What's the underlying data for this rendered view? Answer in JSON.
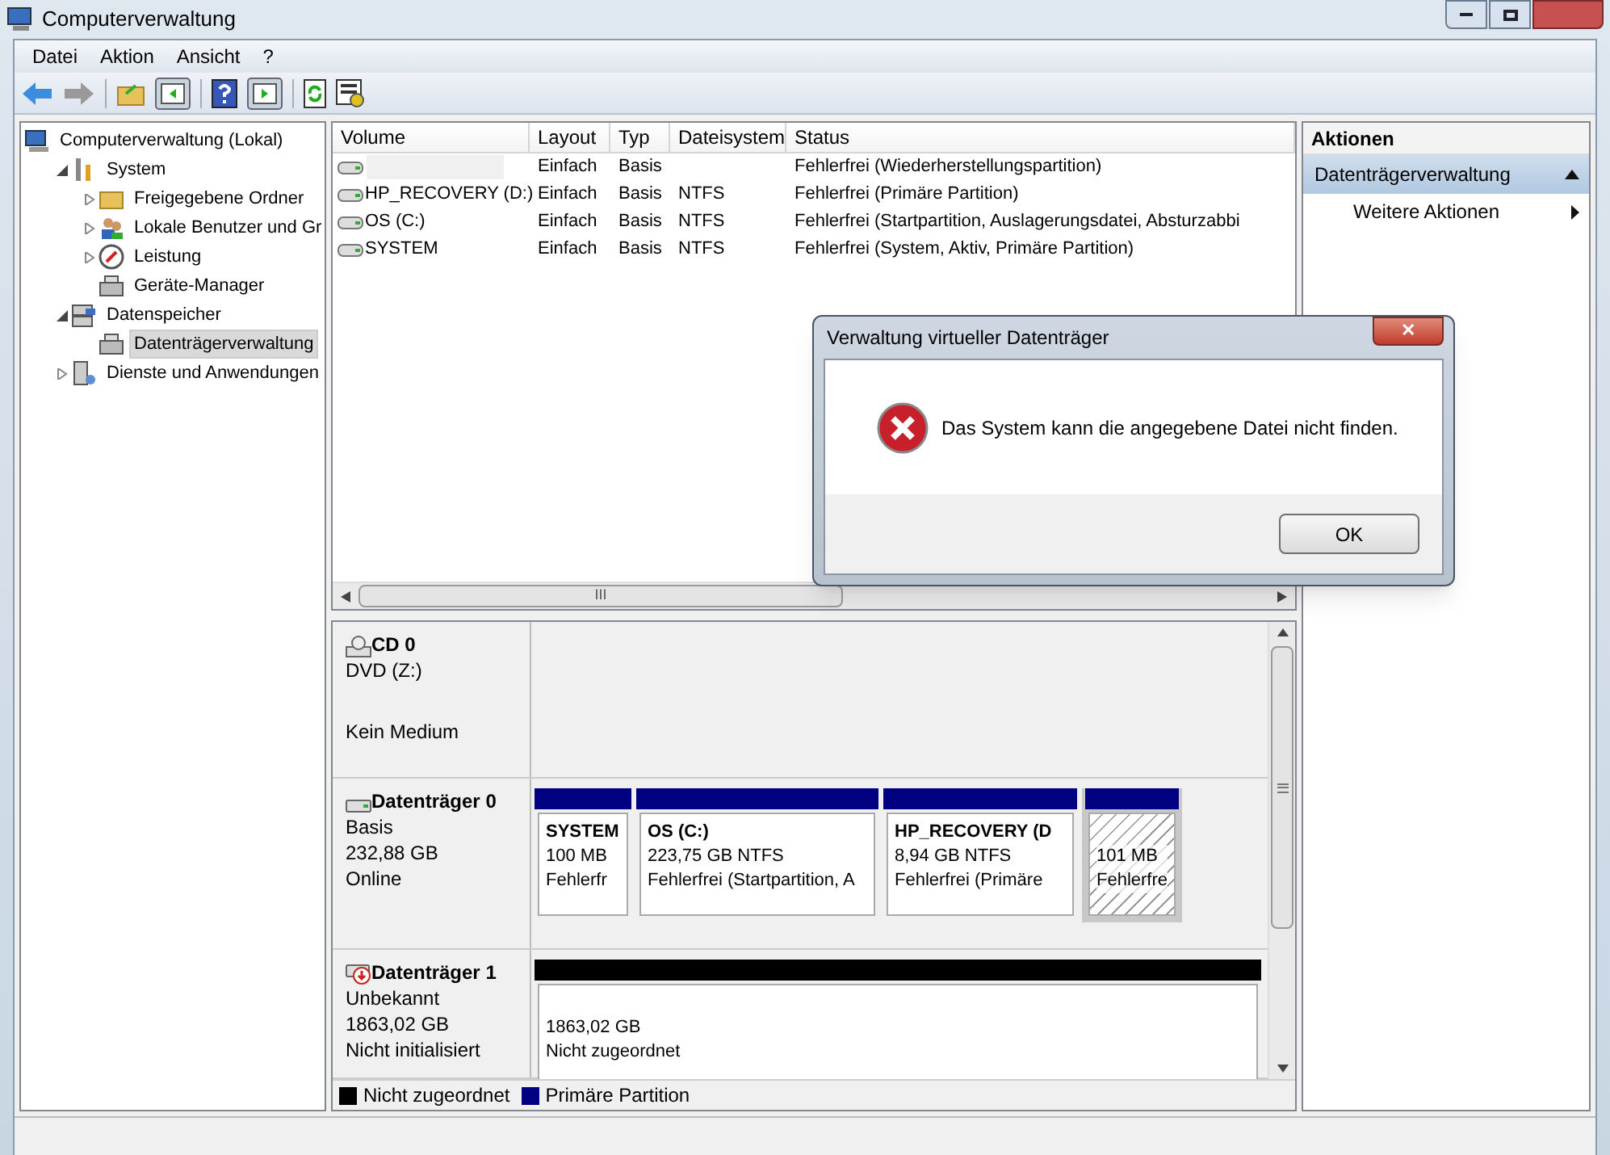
{
  "window": {
    "title": "Computerverwaltung"
  },
  "menu": [
    "Datei",
    "Aktion",
    "Ansicht",
    "?"
  ],
  "tree": [
    {
      "label": "Computerverwaltung (Lokal)",
      "kind": "computer",
      "selected": false,
      "children": [
        {
          "label": "System",
          "kind": "tools",
          "expanded": true,
          "selected": false,
          "children": [
            {
              "label": "Freigegebene Ordner",
              "kind": "folder",
              "expanded": false,
              "selected": false
            },
            {
              "label": "Lokale Benutzer und Gr",
              "kind": "users",
              "expanded": false,
              "selected": false
            },
            {
              "label": "Leistung",
              "kind": "gauge",
              "expanded": false,
              "selected": false
            },
            {
              "label": "Geräte-Manager",
              "kind": "device",
              "selected": false
            }
          ]
        },
        {
          "label": "Datenspeicher",
          "kind": "storage",
          "expanded": true,
          "selected": false,
          "children": [
            {
              "label": "Datenträgerverwaltung",
              "kind": "device",
              "selected": true
            }
          ]
        },
        {
          "label": "Dienste und Anwendungen",
          "kind": "services",
          "expanded": false,
          "selected": false
        }
      ]
    }
  ],
  "volumes": {
    "columns": [
      "Volume",
      "Layout",
      "Typ",
      "Dateisystem",
      "Status"
    ],
    "rows": [
      {
        "layout": "Einfach",
        "type": "Basis",
        "status": "Fehlerfrei (Wiederherstellungspartition)"
      },
      {
        "volume": "HP_RECOVERY (D:)",
        "layout": "Einfach",
        "type": "Basis",
        "filesystem": "NTFS",
        "status": "Fehlerfrei (Primäre Partition)"
      },
      {
        "volume": "OS (C:)",
        "layout": "Einfach",
        "type": "Basis",
        "filesystem": "NTFS",
        "status": "Fehlerfrei (Startpartition, Auslagerungsdatei, Absturzabbi"
      },
      {
        "volume": "SYSTEM",
        "layout": "Einfach",
        "type": "Basis",
        "filesystem": "NTFS",
        "status": "Fehlerfrei (System, Aktiv, Primäre Partition)"
      }
    ],
    "scroll_grip": "III"
  },
  "disks": [
    {
      "kind": "cd",
      "name": "CD 0",
      "lines": [
        "DVD (Z:)",
        "Kein Medium"
      ]
    },
    {
      "kind": "disk",
      "name": "Datenträger 0",
      "lines": [
        "Basis",
        "232,88 GB",
        "Online"
      ],
      "partitions": [
        {
          "kind": "primary",
          "selected": false,
          "title": "SYSTEM",
          "size": "100 MB",
          "status": "Fehlerfr"
        },
        {
          "kind": "primary",
          "selected": false,
          "title": "OS  (C:)",
          "size": "223,75 GB NTFS",
          "status": "Fehlerfrei (Startpartition, A"
        },
        {
          "kind": "primary",
          "selected": false,
          "title": "HP_RECOVERY  (D",
          "size": "8,94 GB NTFS",
          "status": "Fehlerfrei (Primäre"
        },
        {
          "kind": "primary",
          "selected": true,
          "size": "101 MB",
          "status": "Fehlerfre"
        }
      ]
    },
    {
      "kind": "unknown",
      "name": "Datenträger 1",
      "lines": [
        "Unbekannt",
        "1863,02 GB",
        "Nicht initialisiert"
      ],
      "partitions": [
        {
          "kind": "unallocated",
          "selected": false,
          "size": "1863,02 GB",
          "status": "Nicht zugeordnet"
        }
      ]
    }
  ],
  "legend": [
    {
      "label": "Nicht zugeordnet",
      "color": "#000000"
    },
    {
      "label": "Primäre Partition",
      "color": "#000080"
    }
  ],
  "actions": {
    "title": "Aktionen",
    "section": {
      "label": "Datenträgerverwaltung",
      "expanded": true
    },
    "items": [
      "Weitere Aktionen"
    ]
  },
  "dialog": {
    "title": "Verwaltung virtueller Datenträger",
    "message": "Das System kann die angegebene Datei nicht finden.",
    "close": "✕",
    "button": "OK"
  }
}
